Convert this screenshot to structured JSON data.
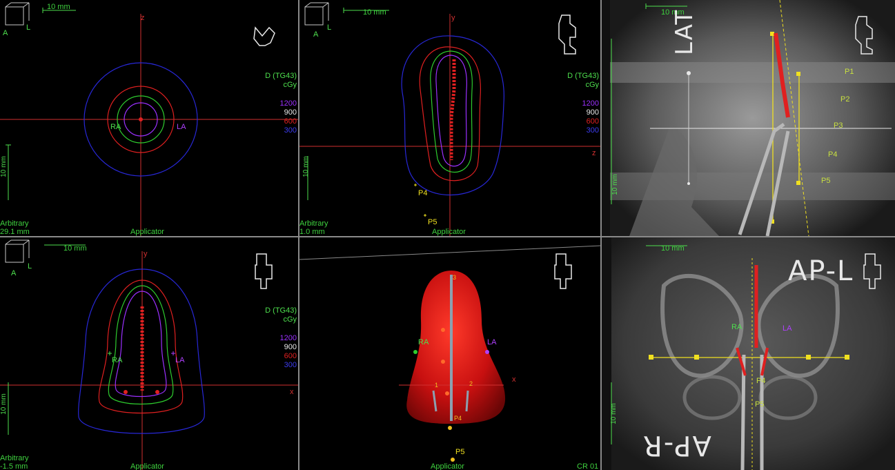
{
  "colors": {
    "isodose_1200": "#9b30ff",
    "isodose_900": "#2ecc2e",
    "isodose_600": "#e02020",
    "isodose_300": "#2828d8",
    "crosshair": "#d23030",
    "ui_text": "#4ee04e",
    "marker": "#f0e020"
  },
  "views": {
    "top_left": {
      "scale_label": "10 mm",
      "scale_label_vertical": "10 mm",
      "axis_label": "z",
      "orientation_a": "A",
      "orientation_l": "L",
      "dose_header_1": "D (TG43)",
      "dose_header_2": "cGy",
      "doses": [
        "1200",
        "900",
        "600",
        "300"
      ],
      "ra_label": "RA",
      "la_label": "LA",
      "mode_label": "Arbitrary",
      "depth_label": "29.1 mm",
      "footer_label": "Applicator",
      "orientation_icon": "pelvis-axial-icon"
    },
    "top_middle": {
      "scale_label": "10 mm",
      "scale_label_vertical": "10 mm",
      "axis_label_y": "y",
      "axis_label_z": "z",
      "orientation_a": "A",
      "orientation_l": "L",
      "dose_header_1": "D (TG43)",
      "dose_header_2": "cGy",
      "doses": [
        "1200",
        "900",
        "600",
        "300"
      ],
      "p4_label": "P4",
      "p5_label": "P5",
      "mode_label": "Arbitrary",
      "depth_label": "1.0 mm",
      "footer_label": "Applicator",
      "footer_label_2": "D (TG43)",
      "orientation_icon": "patient-lateral-icon"
    },
    "top_right": {
      "scale_label": "10 mm",
      "scale_label_vertical": "10 mm",
      "view_title": "LAT",
      "points": [
        "P1",
        "P2",
        "P3",
        "P4",
        "P5"
      ],
      "orientation_icon": "patient-lateral-icon"
    },
    "bottom_left": {
      "scale_label": "10 mm",
      "scale_label_vertical": "10 mm",
      "axis_label_y": "y",
      "axis_label_x": "x",
      "orientation_a": "A",
      "orientation_l": "L",
      "dose_header_1": "D (TG43)",
      "dose_header_2": "cGy",
      "doses": [
        "1200",
        "900",
        "600",
        "300"
      ],
      "ra_label": "RA",
      "la_label": "LA",
      "mode_label": "Arbitrary",
      "depth_label": "-1.5 mm",
      "footer_label": "Applicator",
      "orientation_icon": "patient-frontal-icon"
    },
    "bottom_middle": {
      "ra_label": "RA",
      "la_label": "LA",
      "x_label": "x",
      "p4_label": "P4",
      "p5_label": "P5",
      "channel_1": "1",
      "channel_2": "2",
      "channel_3": "3",
      "footer_label": "Applicator",
      "corner_label": "CR 01",
      "orientation_icon": "patient-frontal-icon"
    },
    "bottom_right": {
      "scale_label": "10 mm",
      "scale_label_vertical": "10 mm",
      "view_title": "AP-L",
      "view_title_2": "AP-R",
      "ra_label": "RA",
      "la_label": "LA",
      "p4_label": "P4",
      "p5_label": "P5",
      "orientation_icon": "patient-frontal-icon"
    }
  }
}
